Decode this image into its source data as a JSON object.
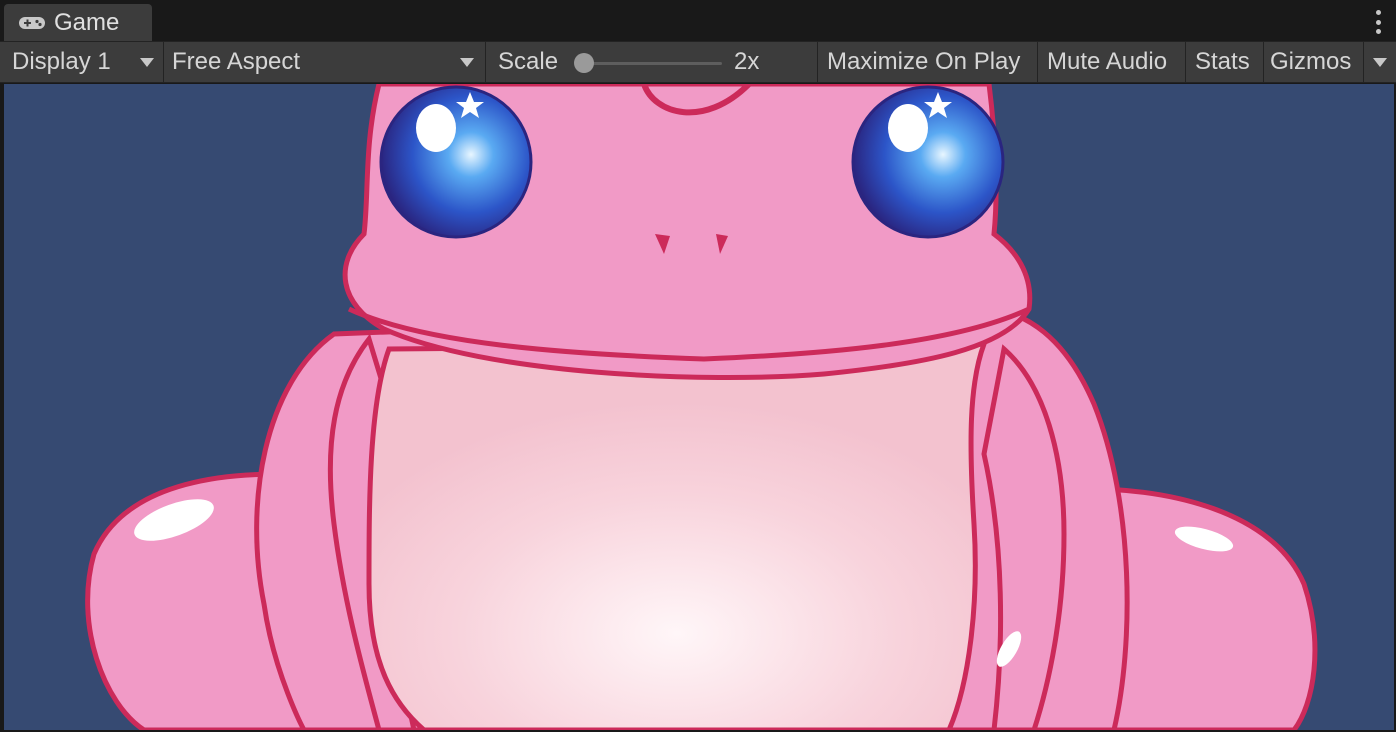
{
  "tab": {
    "label": "Game",
    "icon": "gamepad-icon"
  },
  "toolbar": {
    "display_label": "Display 1",
    "aspect_label": "Free Aspect",
    "scale_label": "Scale",
    "scale_value": "2x",
    "maximize_label": "Maximize On Play",
    "mute_label": "Mute Audio",
    "stats_label": "Stats",
    "gizmos_label": "Gizmos"
  },
  "colors": {
    "viewport_bg": "#364a72",
    "frog_body": "#f19ac6",
    "frog_outline": "#cc2a5a",
    "frog_belly": "#f8d3dc",
    "eye_blue": "#2f6fe0"
  }
}
